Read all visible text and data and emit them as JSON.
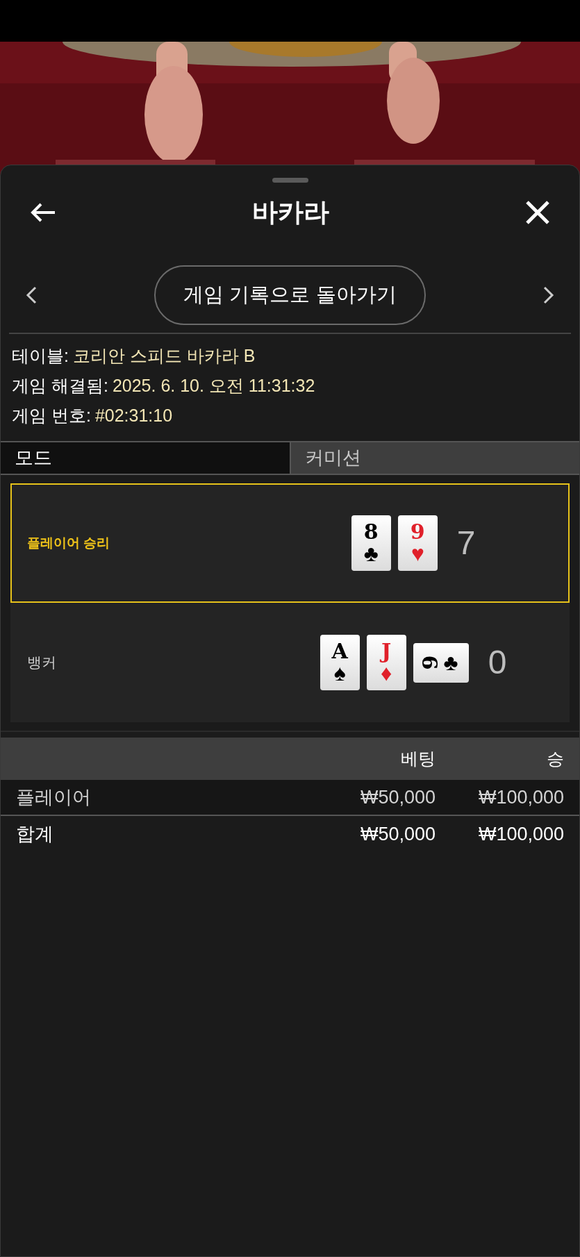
{
  "header": {
    "title": "바카라"
  },
  "nav": {
    "back_to_history": "게임 기록으로 돌아가기"
  },
  "info": [
    {
      "label": "테이블:",
      "value": "코리안 스피드 바카라 B"
    },
    {
      "label": "게임 해결됨:",
      "value": "2025. 6. 10. 오전 11:31:32"
    },
    {
      "label": "게임 번호:",
      "value": "#02:31:10"
    }
  ],
  "tabs": [
    {
      "label": "모드",
      "selected": true
    },
    {
      "label": "커미션",
      "selected": false
    }
  ],
  "hands": [
    {
      "label": "플레이어 승리",
      "winner": true,
      "score": "7",
      "cards": [
        {
          "rank": "8",
          "suit": "♣",
          "sideways": false
        },
        {
          "rank": "9",
          "suit": "♥",
          "sideways": false
        }
      ]
    },
    {
      "label": "뱅커",
      "winner": false,
      "score": "0",
      "cards": [
        {
          "rank": "A",
          "suit": "♠",
          "sideways": false
        },
        {
          "rank": "J",
          "suit": "♦",
          "sideways": false
        },
        {
          "rank": "9",
          "suit": "♣",
          "sideways": true
        }
      ]
    }
  ],
  "table": {
    "columns": [
      "",
      "베팅",
      "승"
    ],
    "rows": [
      {
        "cells": [
          "플레이어",
          "₩50,000",
          "₩100,000"
        ]
      }
    ],
    "total": {
      "cells": [
        "합계",
        "₩50,000",
        "₩100,000"
      ]
    }
  }
}
